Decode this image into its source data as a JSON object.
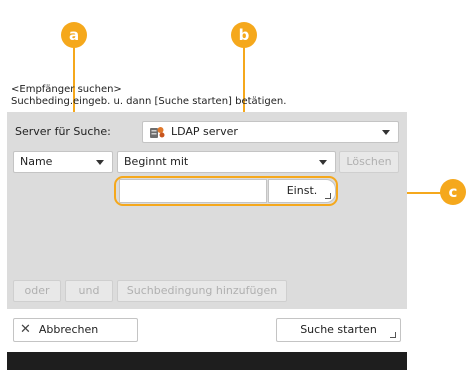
{
  "callouts": {
    "a": "a",
    "b": "b",
    "c": "c",
    "color": "#f5a81c"
  },
  "header": {
    "line1": "<Empfänger suchen>",
    "line2": "Suchbeding.eingeb. u. dann [Suche starten] betätigen."
  },
  "server": {
    "label": "Server für Suche:",
    "value": "LDAP server",
    "icon": "ldap-server-icon"
  },
  "criteria": {
    "attribute": "Name",
    "condition": "Beginnt mit",
    "clear_label": "Löschen",
    "input_value": "",
    "set_label": "Einst."
  },
  "logic": {
    "or_label": "oder",
    "and_label": "und",
    "add_label": "Suchbedingung hinzufügen"
  },
  "footer": {
    "cancel_label": "Abbrechen",
    "start_label": "Suche starten"
  },
  "colors": {
    "panel": "#dcdcdc",
    "footer_bar": "#1e1e1e"
  }
}
